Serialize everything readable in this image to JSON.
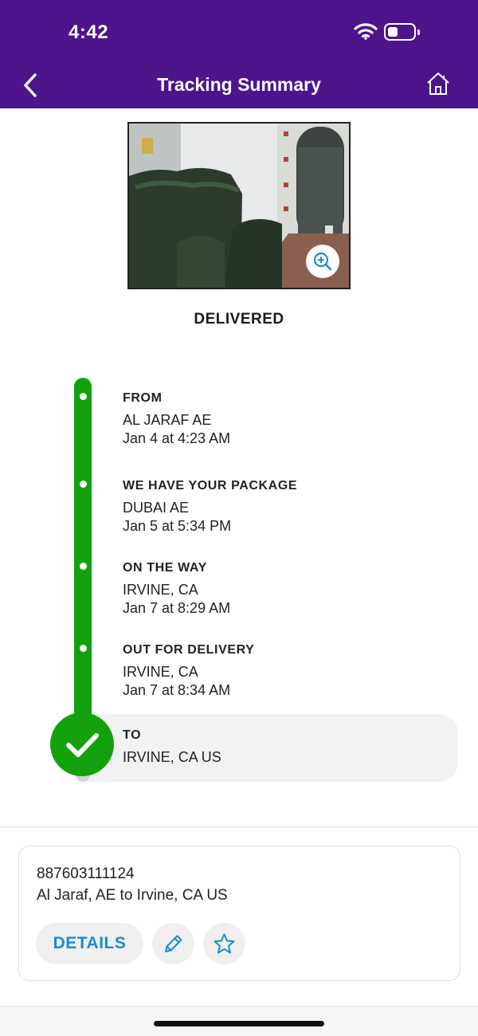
{
  "status_bar": {
    "time": "4:42"
  },
  "header": {
    "title": "Tracking Summary",
    "back_icon": "chevron-left-icon",
    "home_icon": "home-icon",
    "background_color": "#4d148c"
  },
  "delivery_photo": {
    "zoom_icon": "zoom-in-icon"
  },
  "status_title": "DELIVERED",
  "timeline": {
    "accent_color": "#13a10e",
    "events": [
      {
        "label": "FROM",
        "location": "AL JARAF AE",
        "time": "Jan 4 at 4:23 AM"
      },
      {
        "label": "WE HAVE YOUR PACKAGE",
        "location": "DUBAI AE",
        "time": "Jan 5 at 5:34 PM"
      },
      {
        "label": "ON THE WAY",
        "location": "IRVINE, CA",
        "time": "Jan 7 at 8:29 AM"
      },
      {
        "label": "OUT FOR DELIVERY",
        "location": "IRVINE, CA",
        "time": "Jan 7 at 8:34 AM"
      }
    ],
    "destination": {
      "label": "TO",
      "location": "IRVINE, CA  US"
    }
  },
  "shipment_card": {
    "tracking_number": "887603111124",
    "route": "Al Jaraf, AE to Irvine, CA US",
    "details_label": "DETAILS",
    "edit_icon": "pencil-icon",
    "favorite_icon": "star-icon",
    "link_color": "#1a8ccb"
  }
}
